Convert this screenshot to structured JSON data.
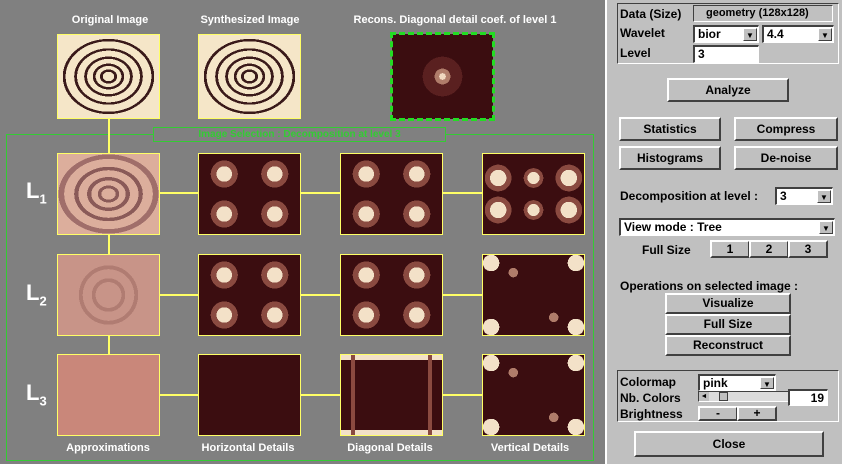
{
  "top_labels": {
    "original": "Original Image",
    "synthesized": "Synthesized Image",
    "recons": "Recons. Diagonal detail coef. of level 1"
  },
  "selection_title": "Image Selection : Decomposition at level 3",
  "levels": [
    "L",
    "L",
    "L"
  ],
  "level_subs": [
    "1",
    "2",
    "3"
  ],
  "column_labels": {
    "approx": "Approximations",
    "horizontal": "Horizontal Details",
    "diagonal": "Diagonal Details",
    "vertical": "Vertical Details"
  },
  "panel": {
    "data_label": "Data  (Size)",
    "data_value": "geometry   (128x128)",
    "wavelet_label": "Wavelet",
    "wavelet_family": "bior",
    "wavelet_number": "4.4",
    "level_label": "Level",
    "level_value": "3",
    "analyze": "Analyze",
    "statistics": "Statistics",
    "compress": "Compress",
    "histograms": "Histograms",
    "denoise": "De-noise",
    "decomp_label": "Decomposition at level :",
    "decomp_value": "3",
    "view_mode": "View mode : Tree",
    "full_size_label": "Full Size",
    "full_size_buttons": [
      "1",
      "2",
      "3"
    ],
    "ops_label": "Operations on selected image :",
    "visualize": "Visualize",
    "full_size": "Full Size",
    "reconstruct": "Reconstruct",
    "colormap_label": "Colormap",
    "colormap_value": "pink",
    "nb_colors_label": "Nb. Colors",
    "nb_colors_value": "19",
    "brightness_label": "Brightness",
    "brightness_minus": "-",
    "brightness_plus": "+",
    "close": "Close"
  },
  "colors": {
    "background": "#808080",
    "panel": "#c0c0c0",
    "tree_lines": "#ffff66",
    "selection": "#22dd22"
  }
}
